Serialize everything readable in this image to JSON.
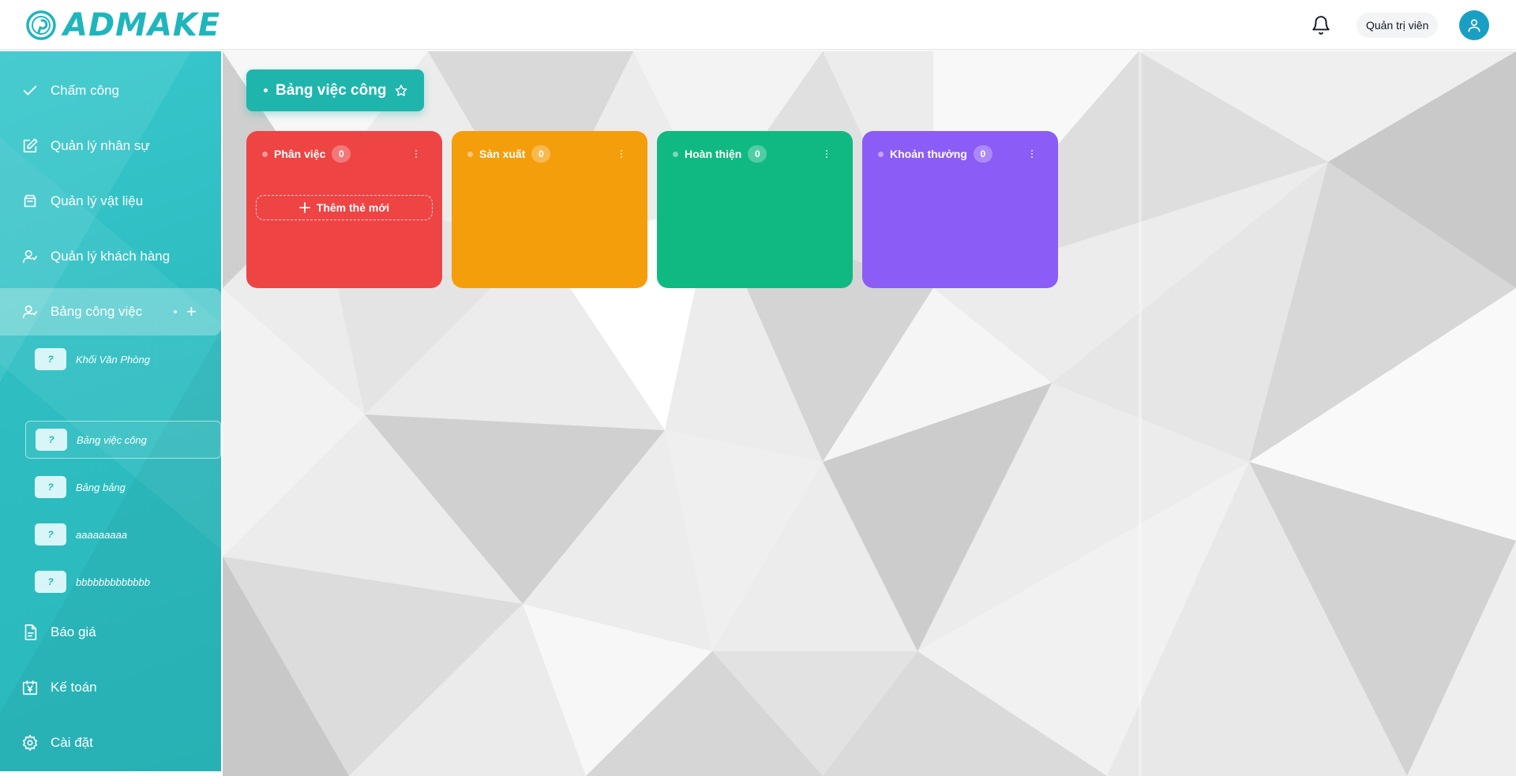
{
  "header": {
    "logo_text": "ADMAKE",
    "role_label": "Quản trị viên",
    "icons": {
      "notifications": "bell-icon",
      "user": "user-avatar-icon"
    }
  },
  "colors": {
    "brand": "#1fb5bd",
    "sidebar": "#2ebec2",
    "col_red": "#ef4444",
    "col_orange": "#f59e0b",
    "col_green": "#10b981",
    "col_purple": "#8b5cf6",
    "avatar": "#1a9fc4"
  },
  "sidebar": {
    "items": [
      {
        "label": "Chấm công",
        "icon": "check-icon"
      },
      {
        "label": "Quản lý nhân sự",
        "icon": "edit-icon"
      },
      {
        "label": "Quản lý vật liệu",
        "icon": "box-icon"
      },
      {
        "label": "Quản lý khách hàng",
        "icon": "users-icon"
      },
      {
        "label": "Bảng công việc",
        "icon": "users-icon",
        "plus": "+"
      },
      {
        "label": "Báo giá",
        "icon": "document-icon"
      },
      {
        "label": "Kế toán",
        "icon": "calendar-yen-icon"
      },
      {
        "label": "Cài đặt",
        "icon": "gear-icon"
      }
    ],
    "sub_items": [
      {
        "badge": "?",
        "label": "Khối Văn Phòng"
      },
      {
        "badge": "?",
        "label": "Bảng việc công"
      },
      {
        "badge": "?",
        "label": "Bảng bảng"
      },
      {
        "badge": "?",
        "label": "aaaaaaaaa"
      },
      {
        "badge": "?",
        "label": "bbbbbbbbbbbbb"
      }
    ]
  },
  "board": {
    "title": "Bảng việc công",
    "star_icon": "star-outline-icon",
    "add_card_label": "Thêm thẻ mới",
    "columns": [
      {
        "name": "Phân việc",
        "count": "0"
      },
      {
        "name": "Sản xuất",
        "count": "0"
      },
      {
        "name": "Hoàn thiện",
        "count": "0"
      },
      {
        "name": "Khoản thưởng",
        "count": "0"
      }
    ]
  }
}
